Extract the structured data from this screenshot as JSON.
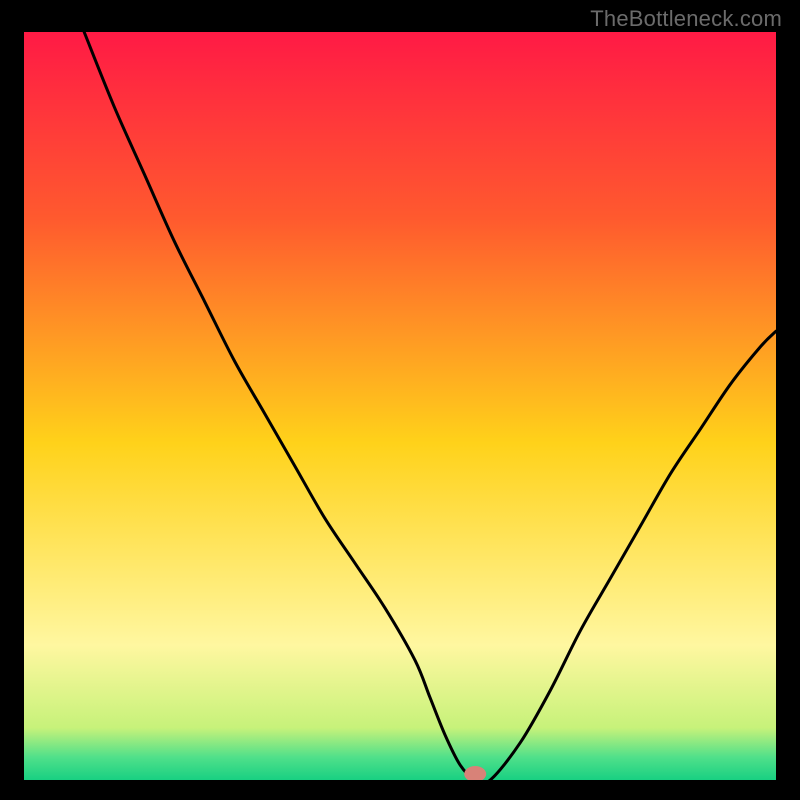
{
  "watermark": "TheBottleneck.com",
  "chart_data": {
    "type": "line",
    "title": "",
    "xlabel": "",
    "ylabel": "",
    "xlim": [
      0,
      100
    ],
    "ylim": [
      0,
      100
    ],
    "x": [
      8,
      12,
      16,
      20,
      24,
      28,
      32,
      36,
      40,
      44,
      48,
      52,
      54,
      56,
      58,
      60,
      62,
      66,
      70,
      74,
      78,
      82,
      86,
      90,
      94,
      98,
      100
    ],
    "values": [
      100,
      90,
      81,
      72,
      64,
      56,
      49,
      42,
      35,
      29,
      23,
      16,
      11,
      6,
      2,
      0,
      0,
      5,
      12,
      20,
      27,
      34,
      41,
      47,
      53,
      58,
      60
    ],
    "minimum_marker": {
      "x": 60,
      "y": 0
    },
    "background": {
      "type": "gradient-vertical",
      "stops": [
        {
          "pos": 0.0,
          "color": "#ff1a45"
        },
        {
          "pos": 0.25,
          "color": "#ff5a2e"
        },
        {
          "pos": 0.55,
          "color": "#ffd21a"
        },
        {
          "pos": 0.82,
          "color": "#fff7a0"
        },
        {
          "pos": 0.93,
          "color": "#c7f27a"
        },
        {
          "pos": 0.97,
          "color": "#4fe08a"
        },
        {
          "pos": 1.0,
          "color": "#18d082"
        }
      ]
    }
  }
}
